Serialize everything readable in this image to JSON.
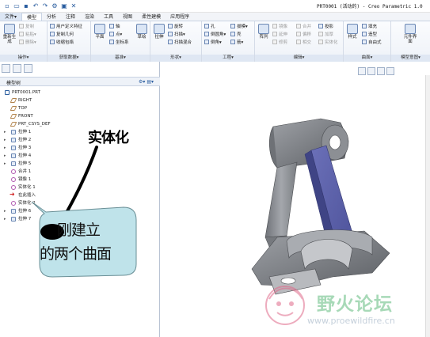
{
  "window": {
    "title": "PRT0001 (活动的) - Creo Parametric 1.0"
  },
  "ribbon_tabs": [
    "文件▾",
    "模型",
    "分析",
    "注释",
    "渲染",
    "工具",
    "视图",
    "柔性建模",
    "应用程序"
  ],
  "active_tab": "模型",
  "ribbon": {
    "operations": {
      "label": "操作▾",
      "regen": "重新生成",
      "items": [
        "复制",
        "粘贴▾",
        "删除▾"
      ]
    },
    "get_data": {
      "label": "获取数据▾",
      "items": [
        "用户定义特征",
        "复制几何",
        "收缩包络"
      ]
    },
    "datum": {
      "label": "基准▾",
      "plane": "平面",
      "items": [
        "轴",
        "点▾",
        "坐标系"
      ],
      "sketch": "草绘"
    },
    "shapes": {
      "label": "形状▾",
      "extrude": "拉伸",
      "items": [
        "旋转",
        "扫描▾",
        "扫描混合"
      ]
    },
    "engineering": {
      "label": "工程▾",
      "items": [
        "孔",
        "倒圆角▾",
        "倒角▾",
        "拔模▾",
        "壳",
        "筋▾"
      ]
    },
    "editing": {
      "label": "编辑▾",
      "pattern": "阵列",
      "items": [
        "镜像",
        "延伸",
        "修剪",
        "合并",
        "偏移",
        "相交",
        "投影",
        "加厚",
        "实体化"
      ]
    },
    "surfaces": {
      "label": "曲面▾",
      "freestyle": "样式",
      "items": [
        "填充",
        "造型",
        "自由式"
      ]
    },
    "model_intent": {
      "label": "模型意图▾",
      "items": [
        "元件界面"
      ]
    }
  },
  "model_tree": {
    "header": "模型树",
    "items": [
      {
        "label": "PRT0001.PRT",
        "level": 0,
        "kind": "root",
        "expander": ""
      },
      {
        "label": "RIGHT",
        "level": 1,
        "kind": "datum",
        "expander": ""
      },
      {
        "label": "TOP",
        "level": 1,
        "kind": "datum",
        "expander": ""
      },
      {
        "label": "FRONT",
        "level": 1,
        "kind": "datum",
        "expander": ""
      },
      {
        "label": "PRT_CSYS_DEF",
        "level": 1,
        "kind": "datum",
        "expander": ""
      },
      {
        "label": "拉伸 1",
        "level": 1,
        "kind": "feat",
        "expander": "▸"
      },
      {
        "label": "拉伸 2",
        "level": 1,
        "kind": "feat",
        "expander": "▸"
      },
      {
        "label": "拉伸 3",
        "level": 1,
        "kind": "feat",
        "expander": "▸"
      },
      {
        "label": "拉伸 4",
        "level": 1,
        "kind": "feat",
        "expander": "▸"
      },
      {
        "label": "拉伸 5",
        "level": 1,
        "kind": "feat",
        "expander": "▸"
      },
      {
        "label": "合并 1",
        "level": 1,
        "kind": "surf",
        "expander": ""
      },
      {
        "label": "镜像 1",
        "level": 1,
        "kind": "surf",
        "expander": ""
      },
      {
        "label": "实体化 1",
        "level": 1,
        "kind": "surf",
        "expander": ""
      },
      {
        "label": "在此插入",
        "level": 1,
        "kind": "insert",
        "expander": ""
      },
      {
        "label": "实体化 2",
        "level": 1,
        "kind": "surf",
        "expander": ""
      },
      {
        "label": "拉伸 6",
        "level": 1,
        "kind": "feat",
        "expander": "▸"
      },
      {
        "label": "拉伸 7",
        "level": 1,
        "kind": "feat",
        "expander": "▸"
      }
    ]
  },
  "annotation": {
    "label": "实体化",
    "callout_line1": "刚建立",
    "callout_line2": "的两个曲面"
  },
  "watermark": {
    "name": "野火论坛",
    "url": "www.proewildfire.cn"
  },
  "colors": {
    "ribbon_accent": "#2a5d9f",
    "model_gray": "#8c8f94",
    "surface_blue": "#5a60a8",
    "callout_fill": "#bfe3ea",
    "watermark_green": "#3caa5f"
  }
}
